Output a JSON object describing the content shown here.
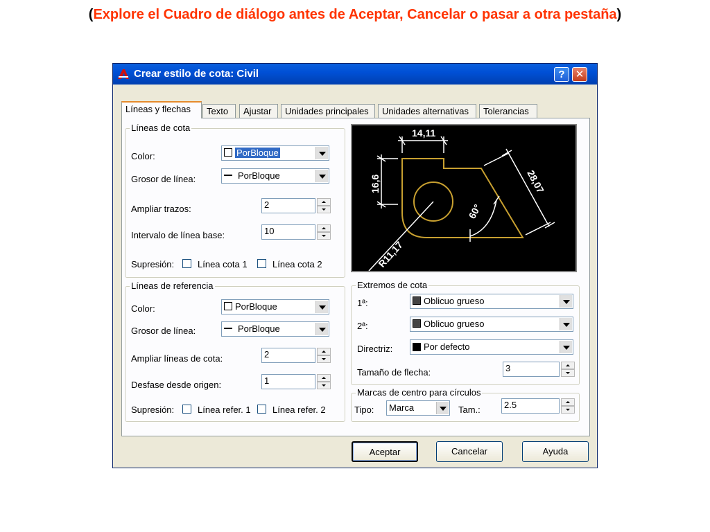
{
  "heading": {
    "open": "(",
    "text": "Explore el Cuadro de diálogo antes de Aceptar, Cancelar o pasar a otra pestaña",
    "close": ")"
  },
  "dialog": {
    "title": "Crear estilo de cota: Civil",
    "help_glyph": "?",
    "close_glyph": "✕"
  },
  "tabs": [
    "Líneas y flechas",
    "Texto",
    "Ajustar",
    "Unidades principales",
    "Unidades alternativas",
    "Tolerancias"
  ],
  "lineas_cota": {
    "legend": "Líneas de cota",
    "color_label": "Color:",
    "color_value": "PorBloque",
    "grosor_label": "Grosor de línea:",
    "grosor_value": "PorBloque",
    "ampliar_label": "Ampliar trazos:",
    "ampliar_value": "2",
    "intervalo_label": "Intervalo de línea base:",
    "intervalo_value": "10",
    "supresion_label": "Supresión:",
    "sup1": "Línea cota 1",
    "sup2": "Línea cota 2"
  },
  "lineas_ref": {
    "legend": "Líneas de referencia",
    "color_label": "Color:",
    "color_value": "PorBloque",
    "grosor_label": "Grosor de línea:",
    "grosor_value": "PorBloque",
    "ampliar_label": "Ampliar líneas de cota:",
    "ampliar_value": "2",
    "desfase_label": "Desfase desde origen:",
    "desfase_value": "1",
    "supresion_label": "Supresión:",
    "sup1": "Línea refer. 1",
    "sup2": "Línea refer. 2"
  },
  "preview": {
    "dim_top": "14,11",
    "dim_left": "16,6",
    "dim_right": "28,07",
    "dim_angle": "60°",
    "dim_radius": "R11,17",
    "accent": "#c8a030"
  },
  "extremos": {
    "legend": "Extremos de cota",
    "first_label": "1ª:",
    "first_value": "Oblicuo grueso",
    "second_label": "2ª:",
    "second_value": "Oblicuo grueso",
    "directriz_label": "Directriz:",
    "directriz_value": "Por defecto",
    "tamano_label": "Tamaño de flecha:",
    "tamano_value": "3"
  },
  "marcas": {
    "legend": "Marcas de centro para círculos",
    "tipo_label": "Tipo:",
    "tipo_value": "Marca",
    "tam_label": "Tam.:",
    "tam_value": "2.5"
  },
  "buttons": {
    "accept": "Aceptar",
    "cancel": "Cancelar",
    "help": "Ayuda"
  }
}
